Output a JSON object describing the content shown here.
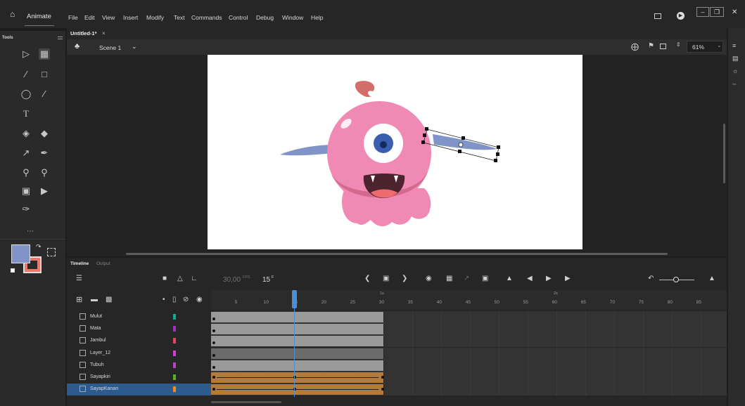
{
  "app": {
    "name": "Animate"
  },
  "menu": [
    "File",
    "Edit",
    "View",
    "Insert",
    "Modify",
    "Text",
    "Commands",
    "Control",
    "Debug",
    "Window",
    "Help"
  ],
  "toolbar": {
    "title": "Tools"
  },
  "document": {
    "tab_label": "Untitled-1*",
    "tab_close": "×",
    "scene_label": "Scene 1",
    "zoom": "61%"
  },
  "timeline": {
    "tab_timeline": "Timeline",
    "tab_output": "Output",
    "fps_value": "30,00",
    "fps_unit": "FPS",
    "frame_value": "15",
    "frame_unit": "F",
    "frame_ticks": [
      "5",
      "10",
      "15",
      "20",
      "25",
      "30",
      "35",
      "40",
      "45",
      "50",
      "55",
      "60",
      "65",
      "70",
      "75",
      "80",
      "85"
    ],
    "second_marks": [
      "1s",
      "2s"
    ],
    "layers": [
      {
        "name": "Mulut",
        "color": "#1aa89a"
      },
      {
        "name": "Mata",
        "color": "#9d2fbf"
      },
      {
        "name": "Jambul",
        "color": "#e8435e"
      },
      {
        "name": "Layer_12",
        "color": "#d63bd6"
      },
      {
        "name": "Tubuh",
        "color": "#b046c8"
      },
      {
        "name": "Sayapkiri",
        "color": "#5aab24"
      },
      {
        "name": "SayapKanan",
        "color": "#f08a1e"
      }
    ],
    "playhead_frame": 15,
    "span_end_frame": 30
  },
  "colors": {
    "accent": "#2d5b8e",
    "monster_pink": "#f089b4",
    "wing": "#8095c8",
    "tween": "#b47a3c"
  },
  "icons": [
    "home-icon",
    "close-icon",
    "scene-icon",
    "chevron-down-icon",
    "selection-icon",
    "free-transform-icon",
    "brush-icon",
    "rectangle-icon",
    "oval-icon",
    "line-icon",
    "text-icon",
    "paint-bucket-icon",
    "eraser-icon",
    "eyedropper-icon",
    "pen-icon",
    "lasso-icon",
    "zoom-icon",
    "camera-icon",
    "play-icon",
    "layers-icon",
    "lock-icon",
    "eye-icon"
  ]
}
